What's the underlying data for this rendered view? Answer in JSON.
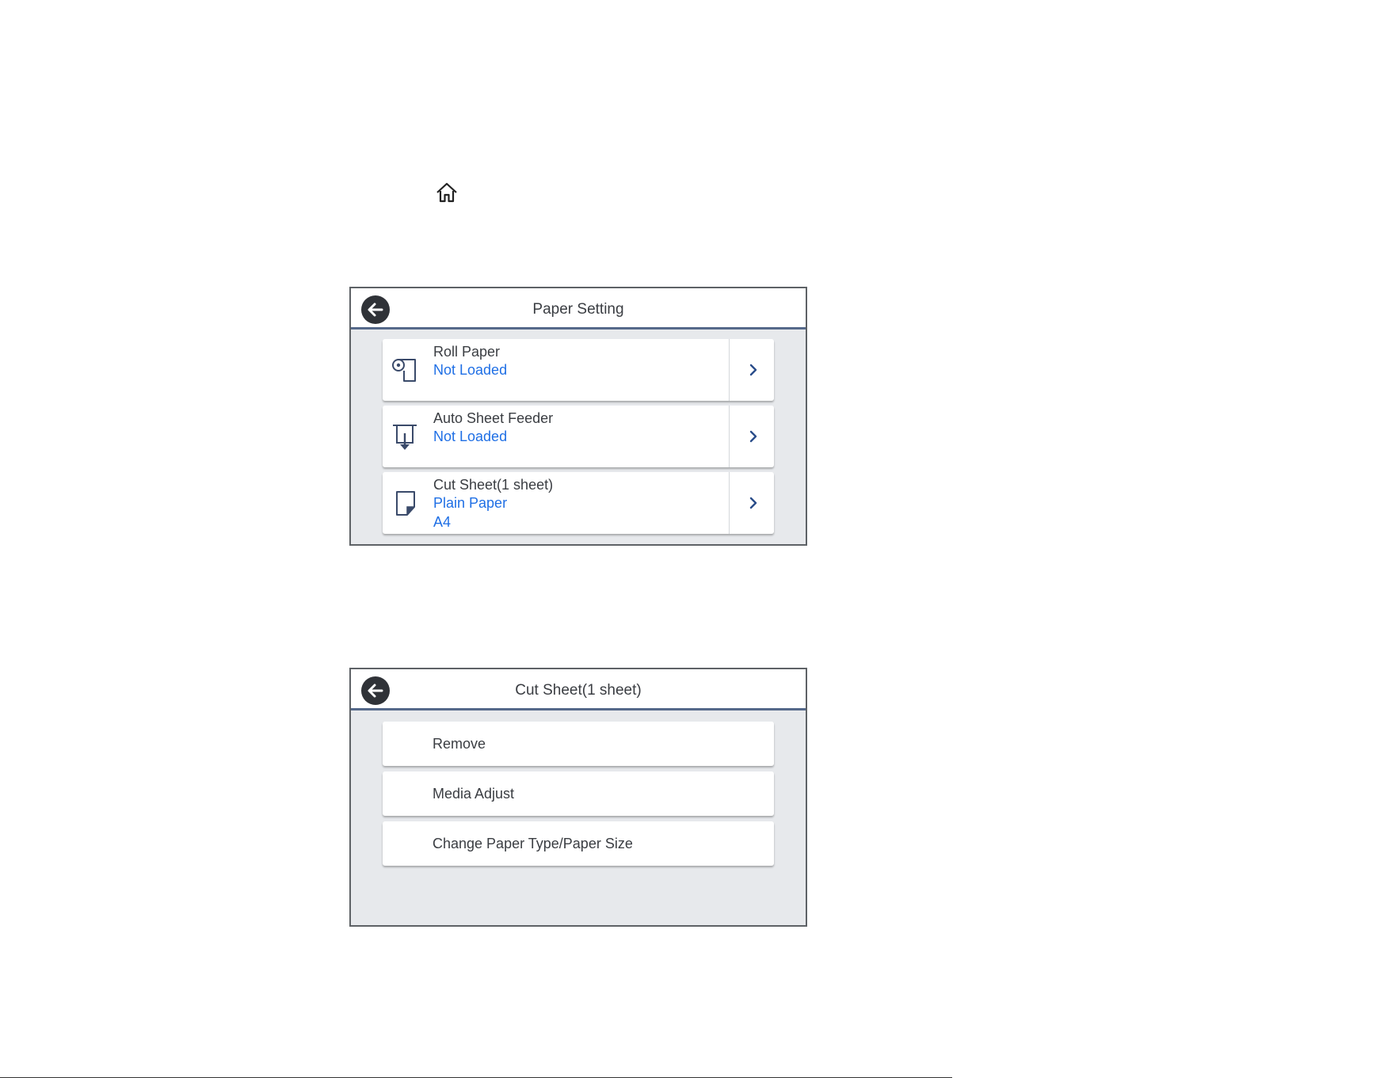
{
  "icons": {
    "home": "home-icon",
    "back": "back-arrow-icon",
    "roll_paper": "roll-paper-icon",
    "auto_sheet_feeder": "auto-sheet-feeder-icon",
    "cut_sheet": "cut-sheet-icon",
    "chevron": "chevron-right-icon"
  },
  "colors": {
    "status_text": "#1f6fe5",
    "header_rule": "#55698a",
    "screen_bg": "#e7e9ec"
  },
  "paper_setting": {
    "title": "Paper Setting",
    "items": [
      {
        "label": "Roll Paper",
        "values": [
          "Not Loaded"
        ]
      },
      {
        "label": "Auto Sheet Feeder",
        "values": [
          "Not Loaded"
        ]
      },
      {
        "label": "Cut Sheet(1 sheet)",
        "values": [
          "Plain Paper",
          "A4"
        ]
      }
    ]
  },
  "cut_sheet_menu": {
    "title": "Cut Sheet(1 sheet)",
    "items": [
      {
        "label": "Remove"
      },
      {
        "label": "Media Adjust"
      },
      {
        "label": "Change Paper Type/Paper Size"
      }
    ]
  }
}
